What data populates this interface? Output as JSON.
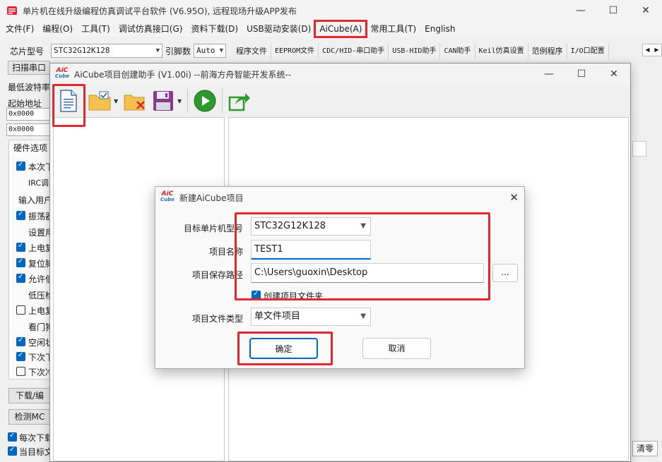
{
  "app": {
    "title": "单片机在线升级编程仿真调试平台软件 (V6.95O), 远程现场升级APP发布",
    "controls": {
      "minimize": "—",
      "maximize": "☐",
      "close": "✕"
    }
  },
  "menu": [
    "文件(F)",
    "编程(O)",
    "工具(T)",
    "调试仿真接口(G)",
    "资料下载(D)",
    "USB驱动安装(D)",
    "AiCube(A)",
    "常用工具(T)",
    "English"
  ],
  "left": {
    "chip_label": "芯片型号",
    "chip_value": "STC32G12K128",
    "pins_label": "引脚数",
    "pins_value": "Auto",
    "scan_port": "扫描串口",
    "min_baud": "最低波特率",
    "start_addr": "起始地址",
    "addr1": "0x0000",
    "addr2": "0x0000",
    "hw_options": "硬件选项",
    "options": [
      {
        "text": "本次下",
        "checked": true
      },
      {
        "text": "IRC调",
        "checked": null
      },
      {
        "text": "输入用户",
        "checked": null
      },
      {
        "text": "振荡器",
        "checked": true
      },
      {
        "text": "设置用",
        "checked": null
      },
      {
        "text": "上电复",
        "checked": true
      },
      {
        "text": "复位脚",
        "checked": true
      },
      {
        "text": "允许低",
        "checked": true
      },
      {
        "text": "低压检",
        "checked": null
      },
      {
        "text": "上电复",
        "checked": false
      },
      {
        "text": "看门狗",
        "checked": null
      },
      {
        "text": "空闲状",
        "checked": true
      },
      {
        "text": "下次下",
        "checked": true
      },
      {
        "text": "下次冷",
        "checked": false
      }
    ],
    "download_btn": "下载/编",
    "detect_btn": "检测MC",
    "bottom_opts": [
      {
        "text": "每次下载",
        "checked": true
      },
      {
        "text": "当目标文",
        "checked": true
      }
    ]
  },
  "tabs": [
    "程序文件",
    "EEPROM文件",
    "CDC/HID-串口助手",
    "USB-HID助手",
    "CAN助手",
    "Keil仿真设置",
    "范例程序",
    "I/O口配置"
  ],
  "clear_btn": "清零",
  "helper": {
    "title": "AiCube项目创建助手 (V1.00i) --前海方舟智能开发系统--",
    "logo_top": "AiC",
    "logo_bottom": "Cube"
  },
  "dialog": {
    "title": "新建AiCube项目",
    "close": "✕",
    "target_label": "目标单片机型号",
    "target_value": "STC32G12K128",
    "name_label": "项目名称",
    "name_value": "TEST1",
    "path_label": "项目保存路径",
    "path_value": "C:\\Users\\guoxin\\Desktop",
    "browse": "...",
    "create_folder": "创建项目文件夹",
    "type_label": "项目文件类型",
    "type_value": "单文件项目",
    "ok": "确定",
    "cancel": "取消"
  }
}
